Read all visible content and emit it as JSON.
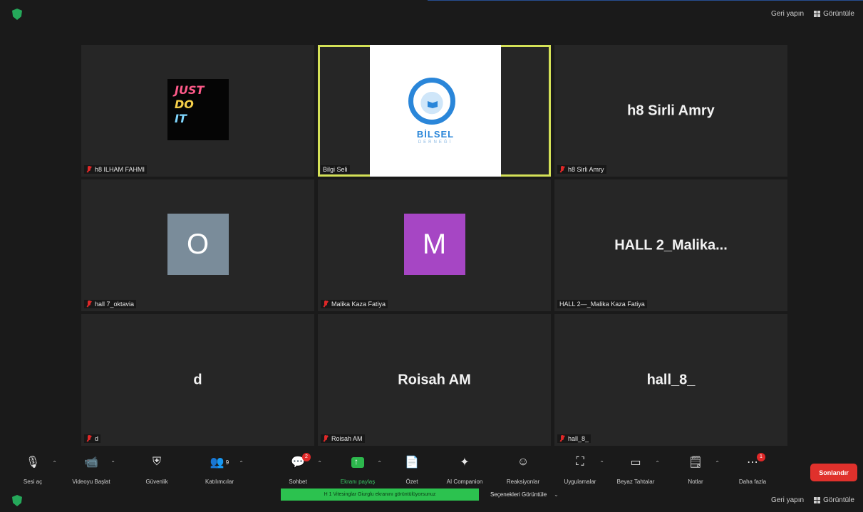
{
  "top_bar": {
    "right_buttons": [
      {
        "label": "Geri yapın"
      },
      {
        "label": "Görüntüle"
      }
    ]
  },
  "participants": [
    {
      "display_name": "",
      "label": "h8 ILHAM FAHMI",
      "media": "just-do-it-image",
      "image_text": [
        "JUST",
        "DO",
        "IT"
      ],
      "muted": true
    },
    {
      "display_name": "",
      "label": "Bilgi Seli",
      "media": "shared-logo",
      "logo_text": "BİLSEL",
      "logo_sub": "DERNEĞİ",
      "muted": false,
      "active_speaker": true
    },
    {
      "display_name": "h8 Sirli Amry",
      "label": "h8 Sirli Amry",
      "media": "name",
      "muted": true
    },
    {
      "display_name": "",
      "label": "hall 7_oktavia",
      "media": "avatar",
      "avatar_letter": "O",
      "avatar_color": "#7a8c9a",
      "muted": true
    },
    {
      "display_name": "",
      "label": "Malika Kaza Fatiya",
      "media": "avatar",
      "avatar_letter": "M",
      "avatar_color": "#a646c4",
      "muted": true
    },
    {
      "display_name": "HALL 2_Malika...",
      "label": "HALL 2—_Malika Kaza Fatiya",
      "media": "name",
      "muted": false
    },
    {
      "display_name": "d",
      "label": "d",
      "media": "name",
      "muted": true
    },
    {
      "display_name": "Roisah AM",
      "label": "Roisah AM",
      "media": "name",
      "muted": true
    },
    {
      "display_name": "hall_8_",
      "label": "hall_8_",
      "media": "name",
      "muted": true
    }
  ],
  "toolbar": {
    "items": [
      {
        "label": "Sesi aç",
        "icon": "microphone-icon",
        "caret": true
      },
      {
        "label": "Videoyu Başlat",
        "icon": "video-camera-icon",
        "caret": true
      },
      {
        "label": "Güvenlik",
        "icon": "security-shield-icon",
        "caret": false
      },
      {
        "label": "Katılımcılar",
        "icon": "participants-icon",
        "caret": true,
        "count": "9"
      },
      {
        "label": "Sohbet",
        "icon": "chat-icon",
        "caret": true,
        "badge": "2"
      },
      {
        "label": "Ekranı paylaş",
        "icon": "share-screen-icon",
        "caret": true
      },
      {
        "label": "Özet",
        "icon": "summary-doc-icon",
        "caret": false
      },
      {
        "label": "AI Companion",
        "icon": "ai-sparkle-icon",
        "caret": false
      },
      {
        "label": "Reaksiyonlar",
        "icon": "reaction-icon",
        "caret": false
      },
      {
        "label": "Uygulamalar",
        "icon": "apps-icon",
        "caret": true
      },
      {
        "label": "Beyaz Tahtalar",
        "icon": "whiteboard-icon",
        "caret": true
      },
      {
        "label": "Notlar",
        "icon": "notes-icon",
        "caret": true
      },
      {
        "label": "Daha fazla",
        "icon": "more-dots-icon",
        "caret": false,
        "badge": "1"
      }
    ],
    "end_button": "Sonlandır"
  },
  "bottom_bar": {
    "notice": "H 1 Vitesinglar Giurglu ekranını görüntülüyorsunuz",
    "view_select": "Seçenekleri Görüntüle"
  },
  "colors": {
    "background": "#1a1a1a",
    "tile": "#262626",
    "active_border": "#d4e157",
    "end_button": "#e0312c",
    "share_green": "#2cc24f"
  }
}
